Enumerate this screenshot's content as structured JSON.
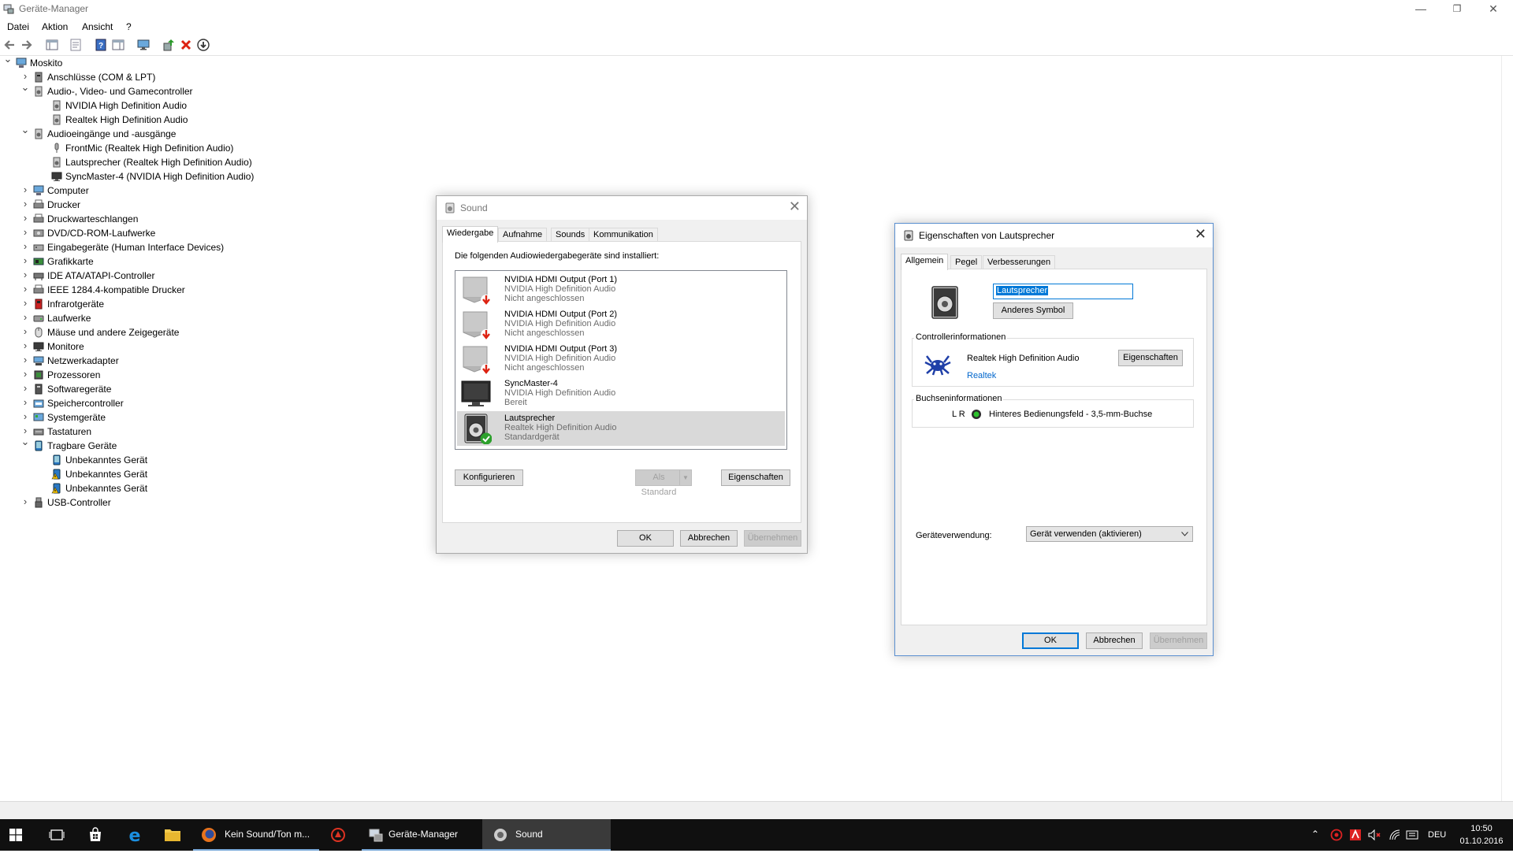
{
  "window": {
    "title": "Geräte-Manager",
    "controls": [
      "—",
      "❐",
      "✕"
    ]
  },
  "menu": [
    "Datei",
    "Aktion",
    "Ansicht",
    "?"
  ],
  "toolbar": [
    "back-icon",
    "forward-icon",
    "show-hide-tree-icon",
    "properties-icon",
    "help-icon",
    "action-pane-icon",
    "monitor-icon",
    "update-driver-icon",
    "uninstall-icon",
    "download-icon"
  ],
  "tree": [
    {
      "label": "Moskito",
      "level": 0,
      "exp": "v",
      "icon": "computer-icon"
    },
    {
      "label": "Anschlüsse (COM & LPT)",
      "level": 1,
      "exp": ">",
      "icon": "port-icon"
    },
    {
      "label": "Audio-, Video- und Gamecontroller",
      "level": 1,
      "exp": "v",
      "icon": "speaker-icon"
    },
    {
      "label": "NVIDIA High Definition Audio",
      "level": 2,
      "exp": "",
      "icon": "speaker-icon"
    },
    {
      "label": "Realtek High Definition Audio",
      "level": 2,
      "exp": "",
      "icon": "speaker-icon"
    },
    {
      "label": "Audioeingänge und -ausgänge",
      "level": 1,
      "exp": "v",
      "icon": "speaker-icon"
    },
    {
      "label": "FrontMic (Realtek High Definition Audio)",
      "level": 2,
      "exp": "",
      "icon": "microphone-icon"
    },
    {
      "label": "Lautsprecher (Realtek High Definition Audio)",
      "level": 2,
      "exp": "",
      "icon": "speaker-icon"
    },
    {
      "label": "SyncMaster-4 (NVIDIA High Definition Audio)",
      "level": 2,
      "exp": "",
      "icon": "monitor-icon"
    },
    {
      "label": "Computer",
      "level": 1,
      "exp": ">",
      "icon": "computer-icon"
    },
    {
      "label": "Drucker",
      "level": 1,
      "exp": ">",
      "icon": "printer-icon"
    },
    {
      "label": "Druckwarteschlangen",
      "level": 1,
      "exp": ">",
      "icon": "printer-icon"
    },
    {
      "label": "DVD/CD-ROM-Laufwerke",
      "level": 1,
      "exp": ">",
      "icon": "disc-icon"
    },
    {
      "label": "Eingabegeräte (Human Interface Devices)",
      "level": 1,
      "exp": ">",
      "icon": "hid-icon"
    },
    {
      "label": "Grafikkarte",
      "level": 1,
      "exp": ">",
      "icon": "display-adapter-icon"
    },
    {
      "label": "IDE ATA/ATAPI-Controller",
      "level": 1,
      "exp": ">",
      "icon": "controller-icon"
    },
    {
      "label": "IEEE 1284.4-kompatible Drucker",
      "level": 1,
      "exp": ">",
      "icon": "printer-icon"
    },
    {
      "label": "Infrarotgeräte",
      "level": 1,
      "exp": ">",
      "icon": "infrared-icon"
    },
    {
      "label": "Laufwerke",
      "level": 1,
      "exp": ">",
      "icon": "drive-icon"
    },
    {
      "label": "Mäuse und andere Zeigegeräte",
      "level": 1,
      "exp": ">",
      "icon": "mouse-icon"
    },
    {
      "label": "Monitore",
      "level": 1,
      "exp": ">",
      "icon": "monitor-icon"
    },
    {
      "label": "Netzwerkadapter",
      "level": 1,
      "exp": ">",
      "icon": "network-icon"
    },
    {
      "label": "Prozessoren",
      "level": 1,
      "exp": ">",
      "icon": "cpu-icon"
    },
    {
      "label": "Softwaregeräte",
      "level": 1,
      "exp": ">",
      "icon": "software-device-icon"
    },
    {
      "label": "Speichercontroller",
      "level": 1,
      "exp": ">",
      "icon": "storage-icon"
    },
    {
      "label": "Systemgeräte",
      "level": 1,
      "exp": ">",
      "icon": "system-icon"
    },
    {
      "label": "Tastaturen",
      "level": 1,
      "exp": ">",
      "icon": "keyboard-icon"
    },
    {
      "label": "Tragbare Geräte",
      "level": 1,
      "exp": "v",
      "icon": "portable-device-icon"
    },
    {
      "label": "Unbekanntes Gerät",
      "level": 2,
      "exp": "",
      "icon": "portable-device-icon"
    },
    {
      "label": "Unbekanntes Gerät",
      "level": 2,
      "exp": "",
      "icon": "warning-device-icon"
    },
    {
      "label": "Unbekanntes Gerät",
      "level": 2,
      "exp": "",
      "icon": "warning-device-icon"
    },
    {
      "label": "USB-Controller",
      "level": 1,
      "exp": ">",
      "icon": "usb-icon"
    }
  ],
  "sound": {
    "title": "Sound",
    "tabs": [
      "Wiedergabe",
      "Aufnahme",
      "Sounds",
      "Kommunikation"
    ],
    "intro": "Die folgenden Audiowiedergabegeräte sind installiert:",
    "devices": [
      {
        "name": "NVIDIA HDMI Output (Port 1)",
        "driver": "NVIDIA High Definition Audio",
        "status": "Nicht angeschlossen",
        "icon": "hdmi-speaker-icon",
        "badge": "unplugged",
        "selected": false
      },
      {
        "name": "NVIDIA HDMI Output (Port 2)",
        "driver": "NVIDIA High Definition Audio",
        "status": "Nicht angeschlossen",
        "icon": "hdmi-speaker-icon",
        "badge": "unplugged",
        "selected": false
      },
      {
        "name": "NVIDIA HDMI Output (Port 3)",
        "driver": "NVIDIA High Definition Audio",
        "status": "Nicht angeschlossen",
        "icon": "hdmi-speaker-icon",
        "badge": "unplugged",
        "selected": false
      },
      {
        "name": "SyncMaster-4",
        "driver": "NVIDIA High Definition Audio",
        "status": "Bereit",
        "icon": "monitor-icon",
        "badge": "",
        "selected": false
      },
      {
        "name": "Lautsprecher",
        "driver": "Realtek High Definition Audio",
        "status": "Standardgerät",
        "icon": "speaker-icon",
        "badge": "default",
        "selected": true
      }
    ],
    "btn_configure": "Konfigurieren",
    "btn_default": "Als Standard",
    "btn_properties": "Eigenschaften",
    "btn_ok": "OK",
    "btn_cancel": "Abbrechen",
    "btn_apply": "Übernehmen"
  },
  "props": {
    "title": "Eigenschaften von Lautsprecher",
    "tabs": [
      "Allgemein",
      "Pegel",
      "Verbesserungen"
    ],
    "name_value": "Lautsprecher",
    "btn_change_icon": "Anderes Symbol",
    "controller_group": "Controllerinformationen",
    "controller_name": "Realtek High Definition Audio",
    "controller_vendor": "Realtek",
    "btn_controller_props": "Eigenschaften",
    "jack_group": "Buchseninformationen",
    "jack_channels": "L R",
    "jack_description": "Hinteres Bedienungsfeld - 3,5-mm-Buchse",
    "usage_label": "Geräteverwendung:",
    "usage_value": "Gerät verwenden (aktivieren)",
    "btn_ok": "OK",
    "btn_cancel": "Abbrechen",
    "btn_apply": "Übernehmen"
  },
  "taskbar": {
    "tasks": [
      {
        "label": "Kein Sound/Ton m...",
        "icon": "firefox-icon"
      },
      {
        "label": "Geräte-Manager",
        "icon": "device-manager-icon"
      },
      {
        "label": "Sound",
        "icon": "sound-icon"
      }
    ],
    "language": "DEU",
    "time": "10:50",
    "date": "01.10.2016"
  },
  "colors": {
    "accent": "#0078d7",
    "taskbar": "#101010",
    "selection": "#d9d9d9",
    "link": "#0066cc"
  }
}
